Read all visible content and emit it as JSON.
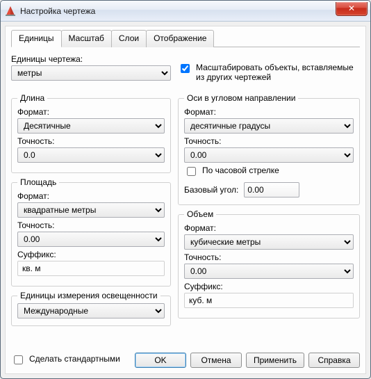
{
  "window": {
    "title": "Настройка чертежа"
  },
  "tabs": {
    "units": "Единицы",
    "scale": "Масштаб",
    "layers": "Слои",
    "display": "Отображение"
  },
  "drawingUnits": {
    "label": "Единицы чертежа:",
    "value": "метры"
  },
  "scaleInserted": {
    "label": "Масштабировать объекты, вставляемые из других чертежей",
    "checked": true
  },
  "length_group": {
    "legend": "Длина"
  },
  "length": {
    "format_label": "Формат:",
    "format_value": "Десятичные",
    "precision_label": "Точность:",
    "precision_value": "0.0"
  },
  "angle_group": {
    "legend": "Оси в угловом направлении"
  },
  "angle": {
    "format_label": "Формат:",
    "format_value": "десятичные градусы",
    "precision_label": "Точность:",
    "precision_value": "0.00",
    "clockwise_label": "По часовой стрелке",
    "clockwise_checked": false,
    "baseangle_label": "Базовый угол:",
    "baseangle_value": "0.00"
  },
  "area_group": {
    "legend": "Площадь"
  },
  "area": {
    "format_label": "Формат:",
    "format_value": "квадратные метры",
    "precision_label": "Точность:",
    "precision_value": "0.00",
    "suffix_label": "Суффикс:",
    "suffix_value": "кв. м"
  },
  "volume_group": {
    "legend": "Объем"
  },
  "volume": {
    "format_label": "Формат:",
    "format_value": "кубические метры",
    "precision_label": "Точность:",
    "precision_value": "0.00",
    "suffix_label": "Суффикс:",
    "suffix_value": "куб. м"
  },
  "lighting_group": {
    "legend": "Единицы измерения освещенности"
  },
  "lighting": {
    "value": "Международные"
  },
  "footer": {
    "make_default_label": "Сделать стандартными",
    "make_default_checked": false,
    "ok": "OK",
    "cancel": "Отмена",
    "apply": "Применить",
    "help": "Справка"
  },
  "icons": {
    "app": "app-icon",
    "close": "✕"
  }
}
